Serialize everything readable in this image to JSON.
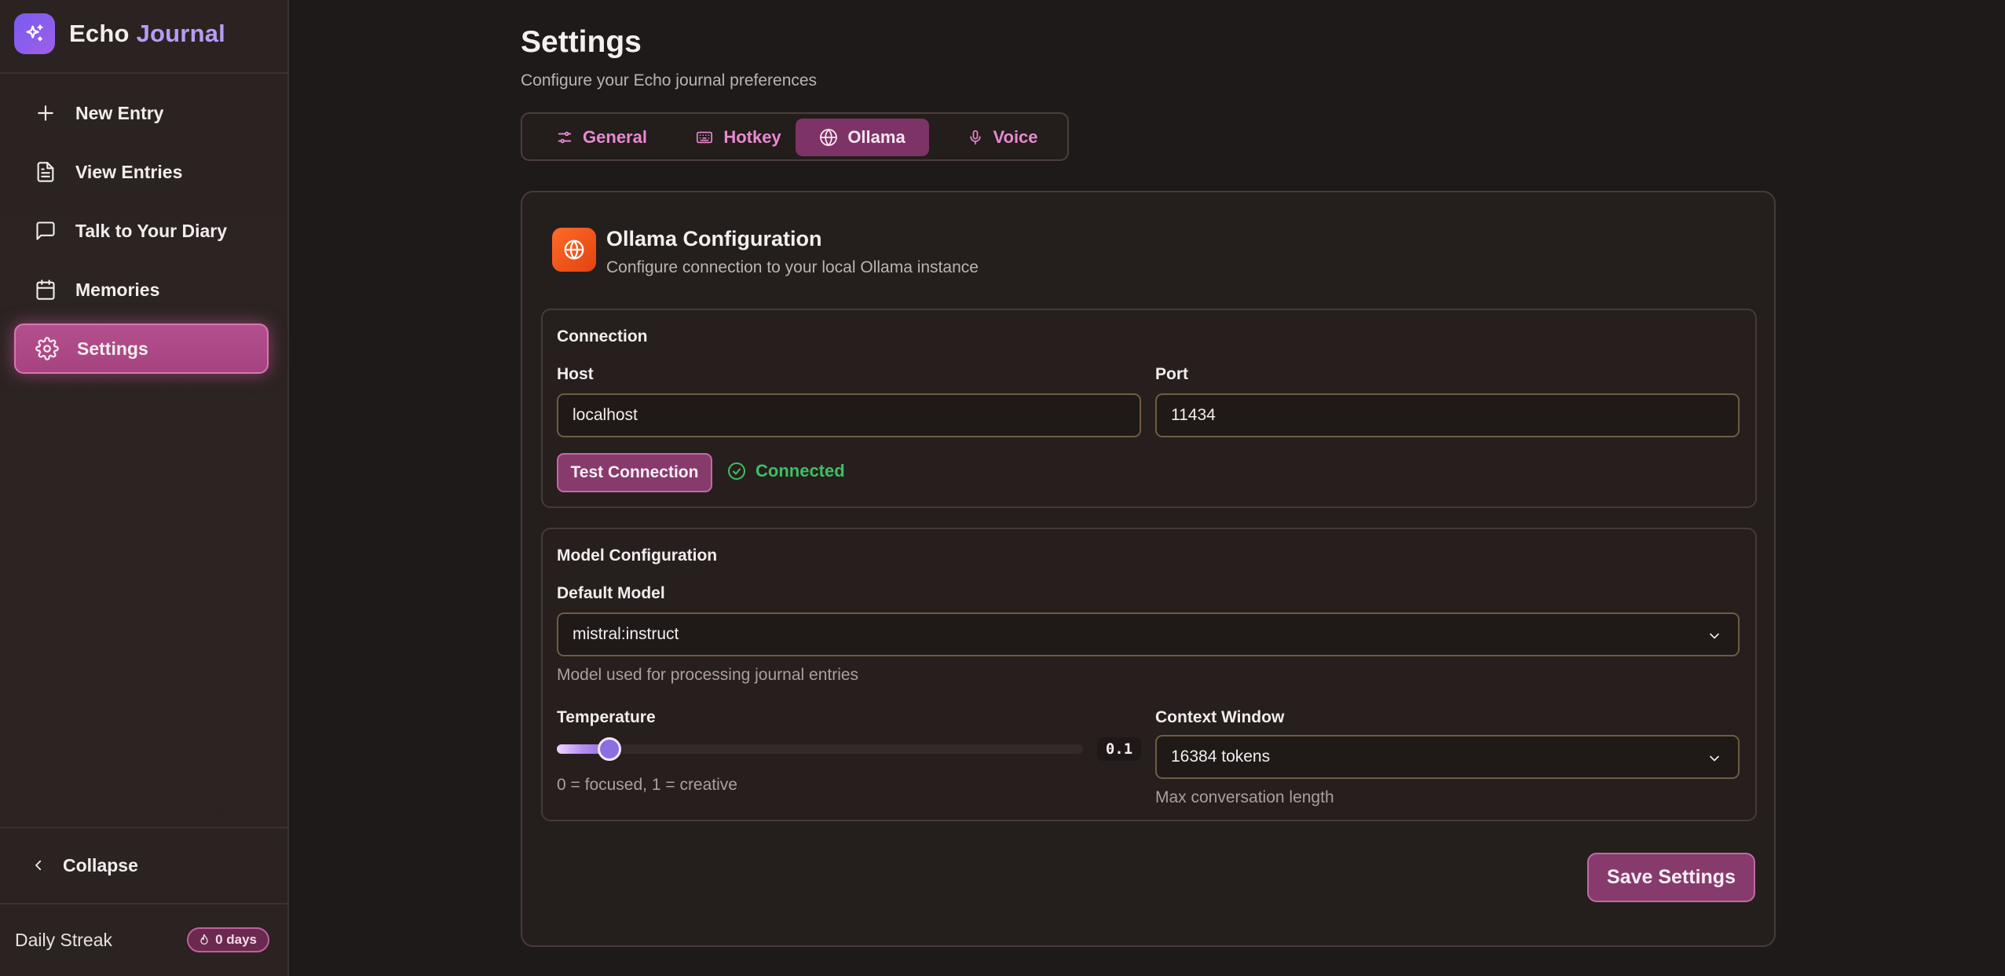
{
  "app": {
    "name_part1": "Echo",
    "name_part2": "Journal"
  },
  "sidebar": {
    "items": [
      {
        "label": "New Entry",
        "icon": "plus-icon"
      },
      {
        "label": "View Entries",
        "icon": "document-icon"
      },
      {
        "label": "Talk to Your Diary",
        "icon": "chat-bubble-icon"
      },
      {
        "label": "Memories",
        "icon": "calendar-icon"
      },
      {
        "label": "Settings",
        "icon": "gear-icon",
        "active": true
      }
    ],
    "collapse_label": "Collapse",
    "streak_label": "Daily Streak",
    "streak_value": "0 days"
  },
  "header": {
    "title": "Settings",
    "subtitle": "Configure your Echo journal preferences"
  },
  "tabs": [
    {
      "label": "General",
      "icon": "sliders-icon"
    },
    {
      "label": "Hotkey",
      "icon": "keyboard-icon"
    },
    {
      "label": "Ollama",
      "icon": "globe-icon",
      "active": true
    },
    {
      "label": "Voice",
      "icon": "microphone-icon"
    }
  ],
  "ollama": {
    "title": "Ollama Configuration",
    "subtitle": "Configure connection to your local Ollama instance",
    "connection": {
      "section_title": "Connection",
      "host_label": "Host",
      "host_value": "localhost",
      "port_label": "Port",
      "port_value": "11434",
      "test_button": "Test Connection",
      "status": "Connected"
    },
    "model": {
      "section_title": "Model Configuration",
      "default_model_label": "Default Model",
      "default_model_value": "mistral:instruct",
      "default_model_help": "Model used for processing journal entries",
      "temperature_label": "Temperature",
      "temperature_value": "0.1",
      "temperature_help": "0 = focused, 1 = creative",
      "context_label": "Context Window",
      "context_value": "16384 tokens",
      "context_help": "Max conversation length"
    },
    "save_button": "Save Settings"
  },
  "colors": {
    "accent": "#863b6c",
    "accent_border": "#c26aa3",
    "tab_text": "#e889cf",
    "success": "#3fbf63",
    "brand_purple": "#7a5cf0",
    "ollama_orange": "#f05a1e"
  }
}
